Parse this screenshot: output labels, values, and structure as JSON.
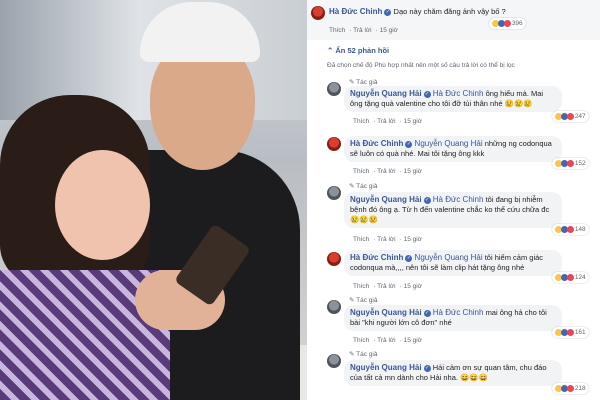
{
  "post": {
    "author": "Hà Đức Chinh",
    "text": "Dạo này chăm đăng ảnh vậy bố ?",
    "reaction_count": "396",
    "actions": [
      "Thích",
      "Trả lời"
    ],
    "time": "15 giờ"
  },
  "hidden_replies": "Ẩn 52 phản hồi",
  "notice": "Đã chọn chế độ Phù hợp nhất nên một số câu trả lời có thể bị lọc",
  "replies": [
    {
      "tag": "Tác giả",
      "author": "Nguyễn Quang Hải",
      "mention": "Hà Đức Chinh",
      "text": "ông hiểu mà. Mai ông tặng quà valentine cho tôi đỡ tủi thân nhé 😢😢😢",
      "count": "247",
      "actions": [
        "Thích",
        "Trả lời"
      ],
      "time": "15 giờ"
    },
    {
      "tag": "",
      "author": "Hà Đức Chinh",
      "mention": "Nguyễn Quang Hải",
      "text": "những ng codonqua sẽ luôn có quà nhé. Mai tôi tặng ông kkk",
      "count": "152",
      "actions": [
        "Thích",
        "Trả lời"
      ],
      "time": "15 giờ"
    },
    {
      "tag": "Tác giả",
      "author": "Nguyễn Quang Hải",
      "mention": "Hà Đức Chinh",
      "text": "tôi đang bị nhiễm bệnh đó ông ạ. Từ h đến valentine chắc ko thể cứu chữa đc😢😢😢",
      "count": "148",
      "actions": [
        "Thích",
        "Trả lời"
      ],
      "time": "15 giờ"
    },
    {
      "tag": "",
      "author": "Hà Đức Chinh",
      "mention": "Nguyễn Quang Hải",
      "text": "tôi hiểm cảm giác codonqua mà,,,, nên tôi sẽ làm clip hát tặng ông nhé",
      "count": "124",
      "actions": [
        "Thích",
        "Trả lời"
      ],
      "time": "15 giờ"
    },
    {
      "tag": "Tác giả",
      "author": "Nguyễn Quang Hải",
      "mention": "Hà Đức Chinh",
      "text": "mai ông hả cho tôi bài \"khi người lớn cô đơn\" nhé",
      "count": "161",
      "actions": [
        "Thích",
        "Trả lời"
      ],
      "time": "15 giờ"
    },
    {
      "tag": "Tác giả",
      "author": "Nguyễn Quang Hải",
      "mention": "",
      "text": "Hải cảm ơn sự quan tâm, chu đáo của tất cả mn dành cho Hải nha. 😄😄😄",
      "count": "218",
      "actions": [],
      "time": ""
    }
  ],
  "colors": {
    "link": "#385898",
    "bubble": "#f2f3f5",
    "meta": "#606770"
  },
  "icons": [
    "verified-icon",
    "pencil-icon",
    "haha-icon",
    "like-icon",
    "love-icon"
  ]
}
